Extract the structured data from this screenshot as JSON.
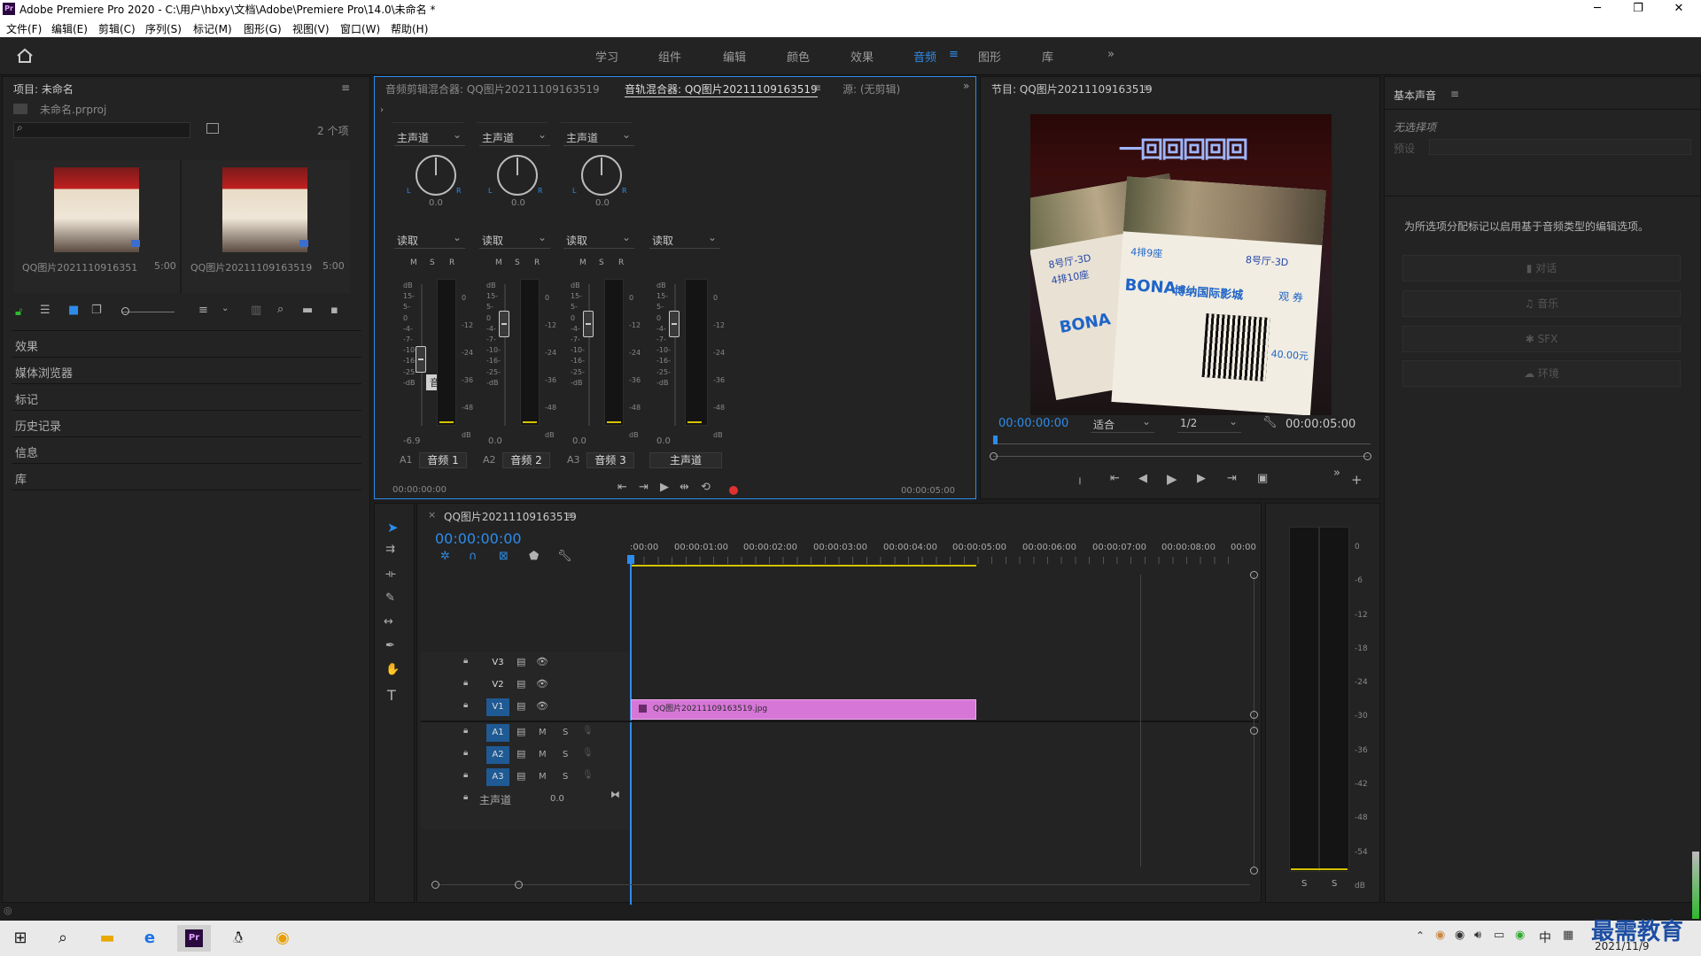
{
  "window": {
    "title": "Adobe Premiere Pro 2020 - C:\\用户\\hbxy\\文档\\Adobe\\Premiere Pro\\14.0\\未命名 *",
    "minimize": "─",
    "maximize": "❐",
    "close": "✕"
  },
  "menu": [
    "文件(F)",
    "编辑(E)",
    "剪辑(C)",
    "序列(S)",
    "标记(M)",
    "图形(G)",
    "视图(V)",
    "窗口(W)",
    "帮助(H)"
  ],
  "workspaces": [
    "学习",
    "组件",
    "编辑",
    "颜色",
    "效果",
    "音频",
    "图形",
    "库"
  ],
  "workspace_more": "»",
  "project": {
    "title": "项目: 未命名",
    "file": "未命名.prproj",
    "search_placeholder": "",
    "count": "2 个项",
    "items": [
      {
        "name": "QQ图片20211109163519...",
        "duration": "5:00"
      },
      {
        "name": "QQ图片20211109163519",
        "duration": "5:00"
      }
    ]
  },
  "left_panels": [
    "效果",
    "媒体浏览器",
    "标记",
    "历史记录",
    "信息",
    "库"
  ],
  "mixer": {
    "tabs": [
      "音频剪辑混合器: QQ图片20211109163519",
      "音轨混合器: QQ图片20211109163519",
      "源: (无剪辑)"
    ],
    "channels": [
      {
        "route": "主声道",
        "pan": "0.0",
        "mode": "读取",
        "gain": "-6.9",
        "id": "A1",
        "name": "音频 1"
      },
      {
        "route": "主声道",
        "pan": "0.0",
        "mode": "读取",
        "gain": "0.0",
        "id": "A2",
        "name": "音频 2"
      },
      {
        "route": "主声道",
        "pan": "0.0",
        "mode": "读取",
        "gain": "0.0",
        "id": "A3",
        "name": "音频 3"
      }
    ],
    "master": {
      "mode": "读取",
      "gain": "0.0",
      "name": "主声道"
    },
    "tooltip": "音量",
    "msr": [
      "M",
      "S",
      "R"
    ],
    "lr": [
      "L",
      "R"
    ],
    "scale_left": [
      "dB",
      "15-",
      "5-",
      "0",
      "-4-",
      "-7-",
      "-10-",
      "-16-",
      "-25-",
      "-dB"
    ],
    "scale_right": [
      "0",
      "-12",
      "-24",
      "-36",
      "-48",
      "dB"
    ],
    "time_start": "00:00:00:00",
    "time_end": "00:00:05:00"
  },
  "program": {
    "title": "节目: QQ图片20211109163519",
    "timecode": "00:00:00:00",
    "fit": "适合",
    "res": "1/2",
    "duration": "00:00:05:00",
    "photo": {
      "sign": "一回回回回回",
      "bona": "BONA",
      "cinema": "博纳国际影城",
      "hall": "8号厅-3D",
      "row": "4排9座",
      "row2": "4排10座",
      "price": "40.00元",
      "voucher": "观 券"
    }
  },
  "essential": {
    "title": "基本声音",
    "no_sel": "无选择项",
    "preset": "预设",
    "hint": "为所选项分配标记以启用基于音频类型的编辑选项。",
    "types": [
      "对话",
      "音乐",
      "SFX",
      "环境"
    ]
  },
  "timeline": {
    "tab": "QQ图片20211109163519",
    "timecode": "00:00:00:00",
    "ruler": [
      ":00:00",
      "00:00:01:00",
      "00:00:02:00",
      "00:00:03:00",
      "00:00:04:00",
      "00:00:05:00",
      "00:00:06:00",
      "00:00:07:00",
      "00:00:08:00",
      "00:00"
    ],
    "video_tracks": [
      "V3",
      "V2",
      "V1"
    ],
    "audio_tracks": [
      "A1",
      "A2",
      "A3"
    ],
    "master": "主声道",
    "master_val": "0.0",
    "clip": "QQ图片20211109163519.jpg",
    "ms": [
      "M",
      "S"
    ]
  },
  "audio_meter": {
    "scale": [
      "0",
      "-6",
      "-12",
      "-18",
      "-24",
      "-30",
      "-36",
      "-42",
      "-48",
      "-54",
      "dB"
    ],
    "solo": [
      "S",
      "S"
    ]
  },
  "taskbar": {
    "ime": "中",
    "date": "2021/11/9",
    "watermark": "最需教育"
  },
  "colors": {
    "accent": "#2d8ceb",
    "clip": "#d676d7",
    "record": "#e03030"
  }
}
